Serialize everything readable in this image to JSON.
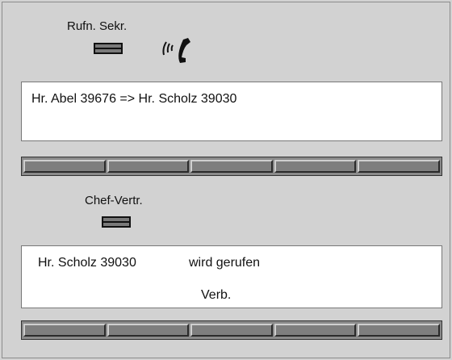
{
  "secretary_call": {
    "label": "Rufn. Sekr.",
    "led_icon": "led-indicator-icon",
    "status_icon": "ringing-handset-icon"
  },
  "display_top": {
    "line1": "Hr. Abel 39676 => Hr. Scholz  39030"
  },
  "keybar_top": {
    "keys": [
      "",
      "",
      "",
      "",
      ""
    ]
  },
  "chef_vertr": {
    "label": "Chef-Vertr.",
    "led_icon": "led-indicator-icon"
  },
  "display_bottom": {
    "line1": "Hr. Scholz 39030",
    "line1_status": "wird gerufen",
    "line2": "Verb."
  },
  "keybar_bottom": {
    "keys": [
      "",
      "",
      "",
      "",
      ""
    ]
  }
}
